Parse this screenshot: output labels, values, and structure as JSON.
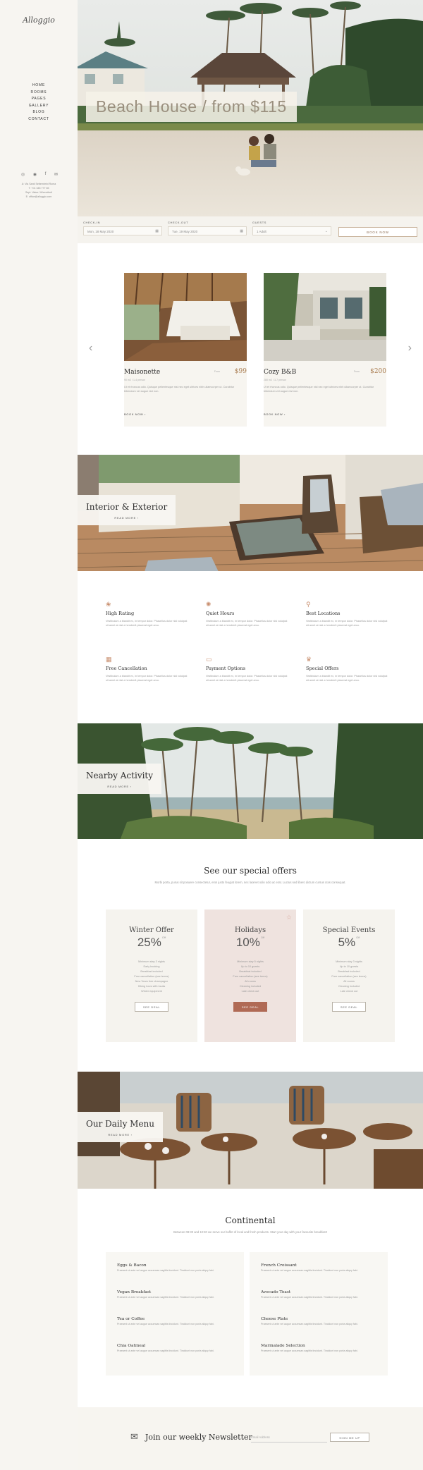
{
  "sidebar": {
    "logo": "Alloggio",
    "nav": [
      "HOME",
      "ROOMS",
      "PAGES",
      "GALLERY",
      "BLOG",
      "CONTACT"
    ],
    "social_icons": [
      "instagram-icon",
      "tripadvisor-icon",
      "facebook-icon",
      "mail-icon"
    ],
    "contact": [
      "A: Via Santi Settembrini Roma",
      "T: +01 345 777 65",
      "Sept. Value: WhereAmit",
      "E: office@alloggio.com"
    ]
  },
  "hero": {
    "title": "Beach House / from $115"
  },
  "booking": {
    "checkin_label": "CHECK-IN",
    "checkin_value": "Mon, 18 May 2020",
    "checkout_label": "CHECK-OUT",
    "checkout_value": "Tue, 19 May 2020",
    "guests_label": "GUESTS",
    "guests_value": "1 Adult",
    "book_label": "BOOK NOW"
  },
  "rooms": {
    "cards": [
      {
        "name": "Maisonette",
        "from": "From",
        "price": "$99",
        "meta": "90 m2 / 1-4 person",
        "desc": "Ut et rhoncus odio. Quisque pellentesque nisl nec eget ultrices nibh ullamcorper ut. Curabitur bibendum vel augue nisl non.",
        "button": "BOOK NOW"
      },
      {
        "name": "Cozy B&B",
        "from": "From",
        "price": "$200",
        "meta": "280 m2 / 3-7 person",
        "desc": "Ut et rhoncus odio. Quisque pellentesque nisl nec eget ultrices nibh ullamcorper ut. Curabitur bibendum vel augue nisl non.",
        "button": "BOOK NOW"
      }
    ]
  },
  "interior": {
    "title": "Interior & Exterior",
    "link": "READ MORE"
  },
  "features": [
    {
      "icon": "ribbon-icon",
      "glyph": "❀",
      "title": "High Rating",
      "desc": "Vestibulum a blandit ex, in tempor dolor. Phasellus dolor nisl volutpat sit amet at nisl a hendrerit placerat eget arcu."
    },
    {
      "icon": "sun-icon",
      "glyph": "✺",
      "title": "Quiet Hours",
      "desc": "Vestibulum a blandit ex, in tempor dolor. Phasellus dolor nisl volutpat sit amet at nisl a hendrerit placerat eget arcu."
    },
    {
      "icon": "location-pin-icon",
      "glyph": "⚲",
      "title": "Best Locations",
      "desc": "Vestibulum a blandit ex, in tempor dolor. Phasellus dolor nisl volutpat sit amet at nisl a hendrerit placerat eget arcu."
    },
    {
      "icon": "calendar-icon",
      "glyph": "▦",
      "title": "Free Cancellation",
      "desc": "Vestibulum a blandit ex, in tempor dolor. Phasellus dolor nisl volutpat sit amet at nisl a hendrerit placerat eget arcu."
    },
    {
      "icon": "card-icon",
      "glyph": "▭",
      "title": "Payment Options",
      "desc": "Vestibulum a blandit ex, in tempor dolor. Phasellus dolor nisl volutpat sit amet at nisl a hendrerit placerat eget arcu."
    },
    {
      "icon": "gift-icon",
      "glyph": "♛",
      "title": "Special Offers",
      "desc": "Vestibulum a blandit ex, in tempor dolor. Phasellus dolor nisl volutpat sit amet at nisl a hendrerit placerat eget arcu."
    }
  ],
  "nearby": {
    "title": "Nearby Activity",
    "link": "READ MORE"
  },
  "offers": {
    "title": "See our special offers",
    "subtitle": "Morbi porta, purus sit posuere consectetur, eros justo feugiat lorem, nec laoreet odio odio ac erat. Luctus sed libero dictum cursus cras consequat.",
    "cards": [
      {
        "name": "Winter Offer",
        "pct": "25%",
        "sup": "Off",
        "items": [
          "Minimum stay 3 nights",
          "Early booking",
          "Breakfast included",
          "Free cancellation (see terms)",
          "New Years free champagne",
          "Hiking tours with locals",
          "Winter equipment"
        ],
        "button": "SEE DEAL"
      },
      {
        "name": "Holidays",
        "pct": "10%",
        "sup": "Off",
        "items": [
          "Minimum stay 5 nights",
          "Up to 10 guests",
          "Breakfast included",
          "Free cancellation (see terms)",
          "All rooms",
          "Cleaning included",
          "Late check out"
        ],
        "button": "SEE DEAL"
      },
      {
        "name": "Special Events",
        "pct": "5%",
        "sup": "Off",
        "items": [
          "Minimum stay 3 nights",
          "Up to 10 guests",
          "Breakfast included",
          "Free cancellation (see terms)",
          "All rooms",
          "Cleaning included",
          "Late check out"
        ],
        "button": "SEE DEAL"
      }
    ]
  },
  "daily_menu": {
    "title": "Our Daily Menu",
    "link": "READ MORE"
  },
  "continental": {
    "title": "Continental",
    "subtitle": "Between 08:30 and 10:30 we serve our buffet of local and fresh products. Start your day with your favourite breakfast!",
    "left": [
      {
        "name": "Eggs & Bacon",
        "desc": "Praesent ut ante vel augue accumsan sagittis tincidunt. Tincidunt non porta aliquy fabi."
      },
      {
        "name": "Vegan Breakfast",
        "desc": "Praesent ut ante vel augue accumsan sagittis tincidunt. Tincidunt non porta aliquy fabi."
      },
      {
        "name": "Tea or Coffee",
        "desc": "Praesent ut ante vel augue accumsan sagittis tincidunt. Tincidunt non porta aliquy fabi."
      },
      {
        "name": "Chia Oatmeal",
        "desc": "Praesent ut ante vel augue accumsan sagittis tincidunt. Tincidunt non porta aliquy fabi."
      }
    ],
    "right": [
      {
        "name": "French Croissant",
        "desc": "Praesent ut ante vel augue accumsan sagittis tincidunt. Tincidunt non porta aliquy fabi."
      },
      {
        "name": "Avocado Toast",
        "desc": "Praesent ut ante vel augue accumsan sagittis tincidunt. Tincidunt non porta aliquy fabi."
      },
      {
        "name": "Cheese Plate",
        "desc": "Praesent ut ante vel augue accumsan sagittis tincidunt. Tincidunt non porta aliquy fabi."
      },
      {
        "name": "Marmalade Selection",
        "desc": "Praesent ut ante vel augue accumsan sagittis tincidunt. Tincidunt non porta aliquy fabi."
      }
    ]
  },
  "newsletter": {
    "title": "Join our weekly Newsletter",
    "placeholder": "Email Address",
    "button": "SIGN ME UP"
  },
  "colors": {
    "accent": "#b06a55",
    "sand": "#f7f5f0",
    "price": "#a97c50"
  }
}
